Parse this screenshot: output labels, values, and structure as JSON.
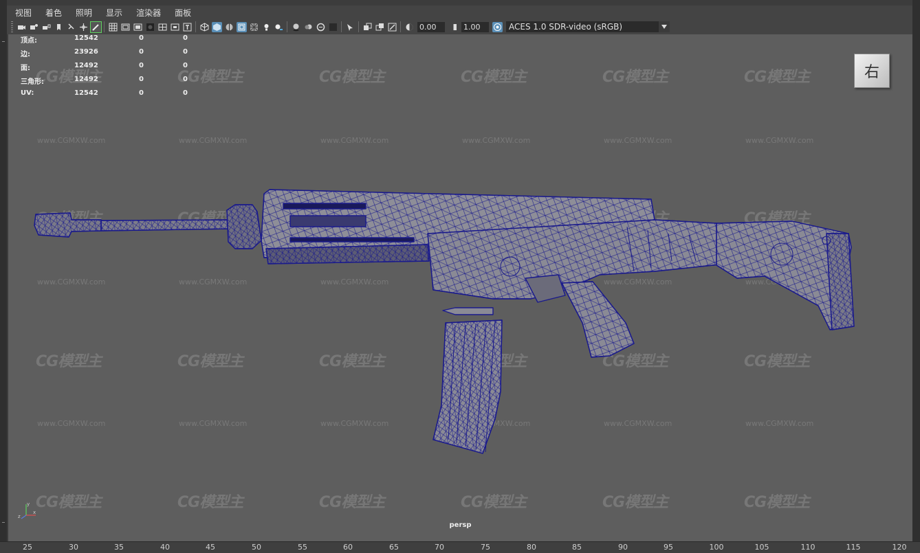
{
  "menubar": {
    "items": [
      "视图",
      "着色",
      "照明",
      "显示",
      "渲染器",
      "面板"
    ]
  },
  "toolbar": {
    "exposure_value": "0.00",
    "gamma_value": "1.00",
    "colorspace_selected": "ACES 1.0 SDR-video (sRGB)",
    "icons": [
      "camera-icon",
      "camera-attributes-icon",
      "camera-lock-icon",
      "bookmark-icon",
      "pin-icon",
      "move-camera-icon",
      "pencil-icon",
      "grid-icon",
      "film-gate-icon",
      "resolution-gate-icon",
      "safe-action-icon",
      "field-chart-icon",
      "safe-title-icon",
      "title-icon",
      "wireframe-icon",
      "smooth-shade-icon",
      "wireframe-on-shaded-icon",
      "xray-cube-icon",
      "textured-icon",
      "lights-icon",
      "shadows-icon",
      "ambient-occlusion-icon",
      "motion-blur-icon",
      "antialias-icon",
      "depth-of-field-icon",
      "isolate-select-icon",
      "xray-icon",
      "xray-joints-icon",
      "backface-icon",
      "exposure-icon",
      "gamma-icon",
      "color-management-icon"
    ]
  },
  "hud": {
    "rows": [
      {
        "label": "顶点:",
        "v1": "12542",
        "v2": "0",
        "v3": "0"
      },
      {
        "label": "边:",
        "v1": "23926",
        "v2": "0",
        "v3": "0"
      },
      {
        "label": "面:",
        "v1": "12492",
        "v2": "0",
        "v3": "0"
      },
      {
        "label": "三角形:",
        "v1": "12492",
        "v2": "0",
        "v3": "0"
      },
      {
        "label": "UV:",
        "v1": "12542",
        "v2": "0",
        "v3": "0"
      }
    ]
  },
  "viewport": {
    "camera": "persp",
    "view_cube_label": "右",
    "watermark_logo": "CG模型主",
    "watermark_url": "www.CGMXW.com",
    "axis_labels": {
      "y": "y",
      "z": "z",
      "x": "x"
    }
  },
  "colors": {
    "viewport_bg": "#5e5e5e",
    "wireframe": "#1a1a8c",
    "accent_blue": "#5a8fb7"
  },
  "timeline": {
    "ticks": [
      "25",
      "30",
      "35",
      "40",
      "45",
      "50",
      "55",
      "60",
      "65",
      "70",
      "75",
      "80",
      "85",
      "90",
      "95",
      "100",
      "105",
      "110",
      "115",
      "120"
    ]
  }
}
